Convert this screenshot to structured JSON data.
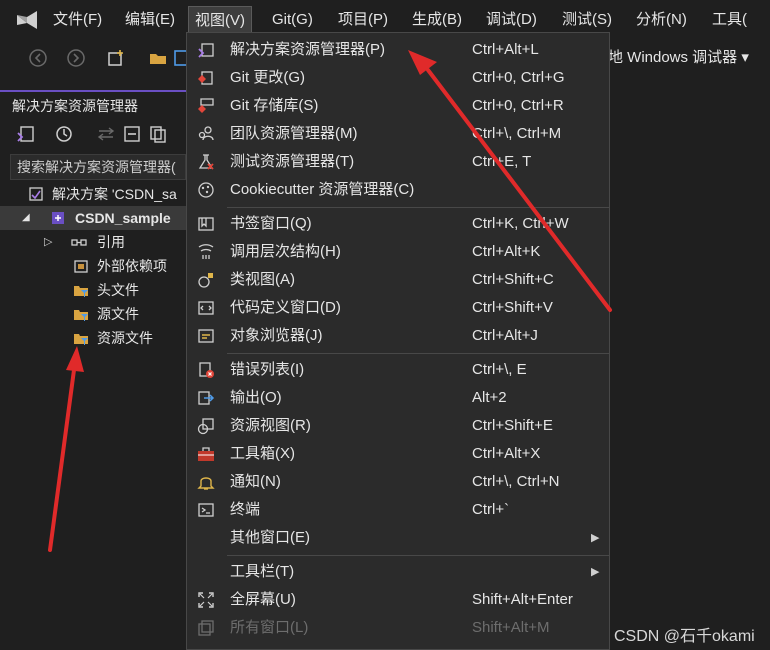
{
  "menubar": {
    "items": [
      "文件(F)",
      "编辑(E)",
      "视图(V)",
      "Git(G)",
      "项目(P)",
      "生成(B)",
      "调试(D)",
      "测试(S)",
      "分析(N)",
      "工具("
    ],
    "active_index": 2
  },
  "toolbar": {
    "debug_target": "地 Windows 调试器 ▾"
  },
  "solution_explorer": {
    "title": "解决方案资源管理器",
    "search_placeholder": "搜索解决方案资源管理器(",
    "tree": [
      {
        "label": "解决方案 'CSDN_sa",
        "icon": "solution-icon",
        "selected": false
      },
      {
        "label": "CSDN_sample",
        "icon": "project-icon",
        "selected": true
      },
      {
        "label": "引用",
        "icon": "references-icon",
        "selected": false
      },
      {
        "label": "外部依赖项",
        "icon": "external-deps-icon",
        "selected": false
      },
      {
        "label": "头文件",
        "icon": "filter-folder-icon",
        "selected": false
      },
      {
        "label": "源文件",
        "icon": "filter-folder-icon",
        "selected": false
      },
      {
        "label": "资源文件",
        "icon": "filter-folder-icon",
        "selected": false
      }
    ]
  },
  "view_menu": {
    "items": [
      {
        "label": "解决方案资源管理器(P)",
        "shortcut": "Ctrl+Alt+L",
        "icon": "solution-explorer-icon"
      },
      {
        "label": "Git 更改(G)",
        "shortcut": "Ctrl+0, Ctrl+G",
        "icon": "git-changes-icon"
      },
      {
        "label": "Git 存储库(S)",
        "shortcut": "Ctrl+0, Ctrl+R",
        "icon": "git-repository-icon"
      },
      {
        "label": "团队资源管理器(M)",
        "shortcut": "Ctrl+\\, Ctrl+M",
        "icon": "team-explorer-icon"
      },
      {
        "label": "测试资源管理器(T)",
        "shortcut": "Ctrl+E, T",
        "icon": "test-explorer-icon"
      },
      {
        "label": "Cookiecutter 资源管理器(C)",
        "shortcut": "",
        "icon": "cookiecutter-icon"
      },
      {
        "label": "书签窗口(Q)",
        "shortcut": "Ctrl+K, Ctrl+W",
        "icon": "bookmark-icon"
      },
      {
        "label": "调用层次结构(H)",
        "shortcut": "Ctrl+Alt+K",
        "icon": "call-hierarchy-icon"
      },
      {
        "label": "类视图(A)",
        "shortcut": "Ctrl+Shift+C",
        "icon": "class-view-icon"
      },
      {
        "label": "代码定义窗口(D)",
        "shortcut": "Ctrl+Shift+V",
        "icon": "code-definition-icon"
      },
      {
        "label": "对象浏览器(J)",
        "shortcut": "Ctrl+Alt+J",
        "icon": "object-browser-icon"
      },
      {
        "label": "错误列表(I)",
        "shortcut": "Ctrl+\\, E",
        "icon": "error-list-icon"
      },
      {
        "label": "输出(O)",
        "shortcut": "Alt+2",
        "icon": "output-icon"
      },
      {
        "label": "资源视图(R)",
        "shortcut": "Ctrl+Shift+E",
        "icon": "resource-view-icon"
      },
      {
        "label": "工具箱(X)",
        "shortcut": "Ctrl+Alt+X",
        "icon": "toolbox-icon"
      },
      {
        "label": "通知(N)",
        "shortcut": "Ctrl+\\, Ctrl+N",
        "icon": "bell-icon"
      },
      {
        "label": "终端",
        "shortcut": "Ctrl+`",
        "icon": "terminal-icon"
      },
      {
        "label": "其他窗口(E)",
        "shortcut": "",
        "icon": "",
        "submenu": true
      },
      {
        "label": "工具栏(T)",
        "shortcut": "",
        "icon": "",
        "submenu": true
      },
      {
        "label": "全屏幕(U)",
        "shortcut": "Shift+Alt+Enter",
        "icon": "fullscreen-icon"
      },
      {
        "label": "所有窗口(L)",
        "shortcut": "Shift+Alt+M",
        "icon": "all-windows-icon",
        "disabled": true
      }
    ]
  },
  "watermark": "CSDN @石千okami",
  "colors": {
    "background": "#1f1f1f",
    "menu_background": "#2b2b2b",
    "accent": "#6a4fc3",
    "annotation_red": "#e02a2a"
  }
}
